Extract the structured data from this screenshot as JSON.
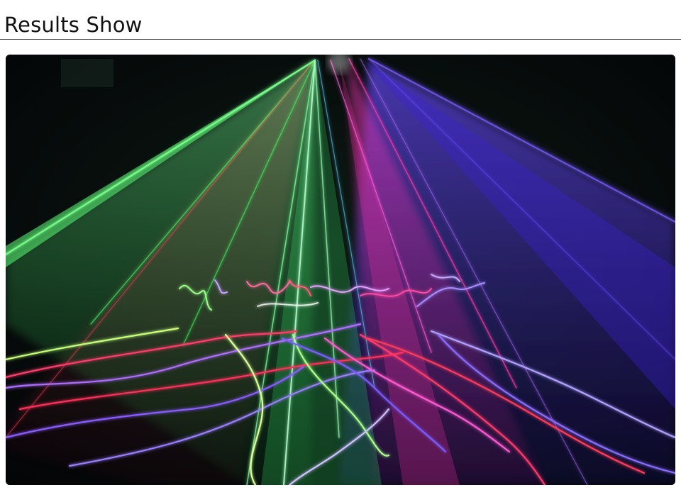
{
  "header": {
    "title": "Results Show"
  },
  "photo": {
    "subject": "laser-light-show",
    "beam_colors": [
      "#39ff5a",
      "#ff2f8f",
      "#5a3cff",
      "#b06cff",
      "#ff3a5a"
    ]
  }
}
